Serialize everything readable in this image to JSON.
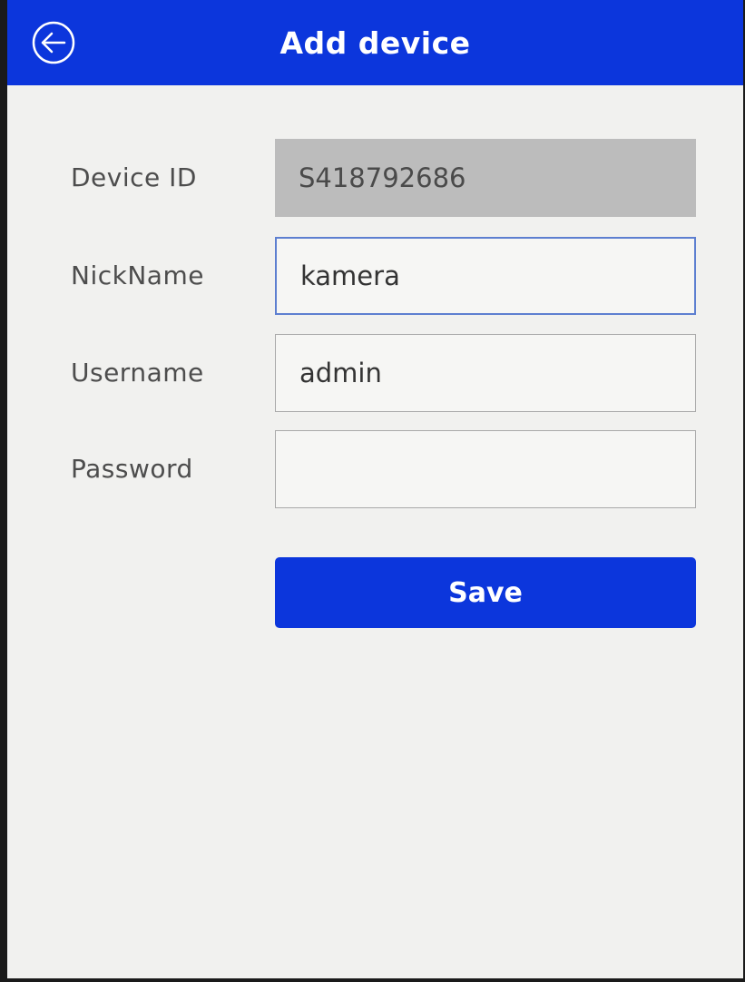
{
  "header": {
    "title": "Add device",
    "back_icon": "arrow-left-circle-icon"
  },
  "form": {
    "device_id": {
      "label": "Device ID",
      "value": "S418792686"
    },
    "nickname": {
      "label": "NickName",
      "value": "kamera"
    },
    "username": {
      "label": "Username",
      "value": "admin"
    },
    "password": {
      "label": "Password",
      "value": ""
    },
    "save_label": "Save"
  },
  "colors": {
    "primary": "#0c36dc",
    "background": "#f1f1ef",
    "readonly_field": "#bcbcbc",
    "focus_border": "#5d7fd0"
  }
}
